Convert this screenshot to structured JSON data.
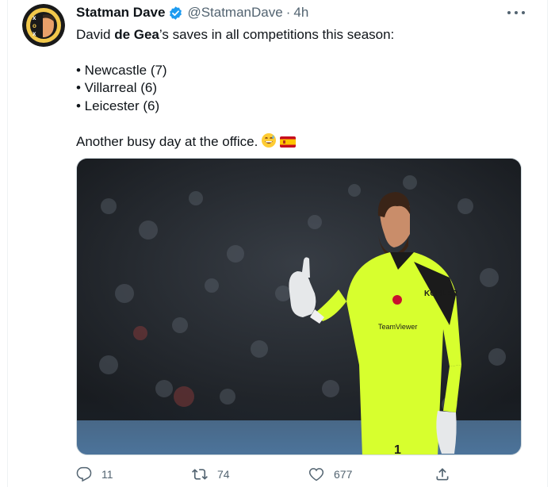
{
  "tweet": {
    "display_name": "Statman Dave",
    "handle": "@StatmanDave",
    "separator": "·",
    "time": "4h",
    "line1_pre": "David ",
    "line1_bold": "de Gea",
    "line1_post": "’s saves in all competitions this season:",
    "bullets": [
      "• Newcastle (7)",
      "• Villarreal (6)",
      "• Leicester (6)"
    ],
    "closing": "Another busy day at the office.",
    "emojis": [
      "grinning-sweat-emoji",
      "spain-flag-emoji"
    ]
  },
  "actions": {
    "replies": "11",
    "retweets": "74",
    "likes": "677"
  },
  "media_text": {
    "sponsor": "KOHLER",
    "shirt_sponsor": "TeamViewer",
    "shirt_number": "1"
  },
  "colors": {
    "verified": "#1d9bf0",
    "secondary_text": "#536471",
    "kit": "#d7ff2e"
  }
}
